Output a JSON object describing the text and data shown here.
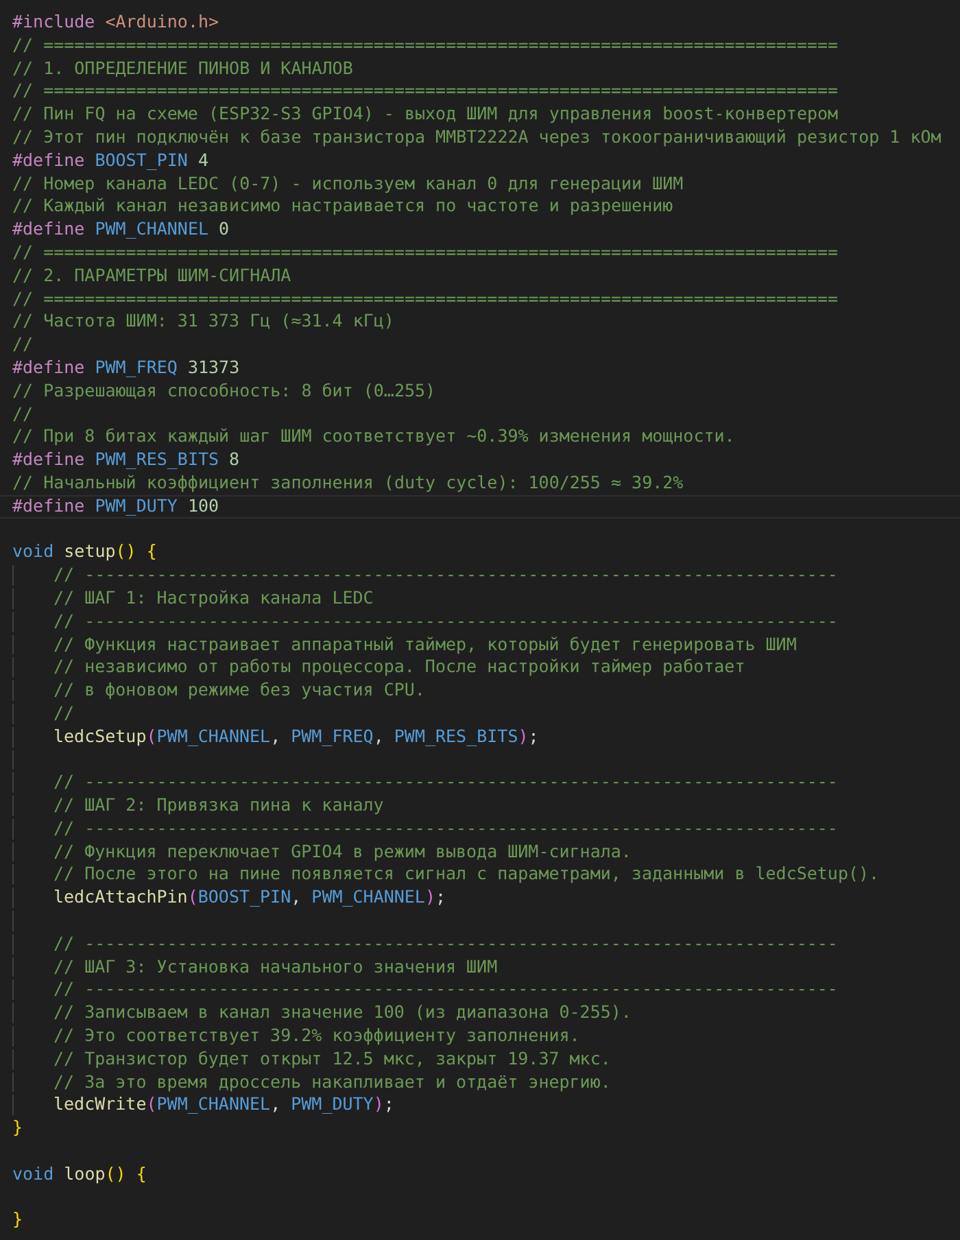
{
  "editor": {
    "lines": [
      {
        "kind": "code",
        "indent": false,
        "current": false,
        "tokens": [
          {
            "kind": "preproc",
            "text": "#include "
          },
          {
            "kind": "string",
            "text": "<Arduino.h>"
          }
        ]
      },
      {
        "kind": "code",
        "indent": false,
        "current": false,
        "tokens": [
          {
            "kind": "comment",
            "text": "// ============================================================================="
          }
        ]
      },
      {
        "kind": "code",
        "indent": false,
        "current": false,
        "tokens": [
          {
            "kind": "comment",
            "text": "// 1. ОПРЕДЕЛЕНИЕ ПИНОВ И КАНАЛОВ"
          }
        ]
      },
      {
        "kind": "code",
        "indent": false,
        "current": false,
        "tokens": [
          {
            "kind": "comment",
            "text": "// ============================================================================="
          }
        ]
      },
      {
        "kind": "code",
        "indent": false,
        "current": false,
        "tokens": [
          {
            "kind": "comment",
            "text": "// Пин FQ на схеме (ESP32-S3 GPIO4) - выход ШИМ для управления boost-конвертером"
          }
        ]
      },
      {
        "kind": "code",
        "indent": false,
        "current": false,
        "tokens": [
          {
            "kind": "comment",
            "text": "// Этот пин подключён к базе транзистора MMBT2222A через токоограничивающий резистор 1 кОм"
          }
        ]
      },
      {
        "kind": "code",
        "indent": false,
        "current": false,
        "tokens": [
          {
            "kind": "preproc",
            "text": "#define "
          },
          {
            "kind": "macro",
            "text": "BOOST_PIN"
          },
          {
            "kind": "number",
            "text": " 4"
          }
        ]
      },
      {
        "kind": "code",
        "indent": false,
        "current": false,
        "tokens": [
          {
            "kind": "comment",
            "text": "// Номер канала LEDC (0-7) - используем канал 0 для генерации ШИМ"
          }
        ]
      },
      {
        "kind": "code",
        "indent": false,
        "current": false,
        "tokens": [
          {
            "kind": "comment",
            "text": "// Каждый канал независимо настраивается по частоте и разрешению"
          }
        ]
      },
      {
        "kind": "code",
        "indent": false,
        "current": false,
        "tokens": [
          {
            "kind": "preproc",
            "text": "#define "
          },
          {
            "kind": "macro",
            "text": "PWM_CHANNEL"
          },
          {
            "kind": "number",
            "text": " 0"
          }
        ]
      },
      {
        "kind": "code",
        "indent": false,
        "current": false,
        "tokens": [
          {
            "kind": "comment",
            "text": "// ============================================================================="
          }
        ]
      },
      {
        "kind": "code",
        "indent": false,
        "current": false,
        "tokens": [
          {
            "kind": "comment",
            "text": "// 2. ПАРАМЕТРЫ ШИМ-СИГНАЛА"
          }
        ]
      },
      {
        "kind": "code",
        "indent": false,
        "current": false,
        "tokens": [
          {
            "kind": "comment",
            "text": "// ============================================================================="
          }
        ]
      },
      {
        "kind": "code",
        "indent": false,
        "current": false,
        "tokens": [
          {
            "kind": "comment",
            "text": "// Частота ШИМ: 31 373 Гц (≈31.4 кГц)"
          }
        ]
      },
      {
        "kind": "code",
        "indent": false,
        "current": false,
        "tokens": [
          {
            "kind": "comment",
            "text": "//"
          }
        ]
      },
      {
        "kind": "code",
        "indent": false,
        "current": false,
        "tokens": [
          {
            "kind": "preproc",
            "text": "#define "
          },
          {
            "kind": "macro",
            "text": "PWM_FREQ"
          },
          {
            "kind": "number",
            "text": " 31373"
          }
        ]
      },
      {
        "kind": "code",
        "indent": false,
        "current": false,
        "tokens": [
          {
            "kind": "comment",
            "text": "// Разрешающая способность: 8 бит (0…255)"
          }
        ]
      },
      {
        "kind": "code",
        "indent": false,
        "current": false,
        "tokens": [
          {
            "kind": "comment",
            "text": "//"
          }
        ]
      },
      {
        "kind": "code",
        "indent": false,
        "current": false,
        "tokens": [
          {
            "kind": "comment",
            "text": "// При 8 битах каждый шаг ШИМ соответствует ~0.39% изменения мощности."
          }
        ]
      },
      {
        "kind": "code",
        "indent": false,
        "current": false,
        "tokens": [
          {
            "kind": "preproc",
            "text": "#define "
          },
          {
            "kind": "macro",
            "text": "PWM_RES_BITS"
          },
          {
            "kind": "number",
            "text": " 8"
          }
        ]
      },
      {
        "kind": "code",
        "indent": false,
        "current": false,
        "tokens": [
          {
            "kind": "comment",
            "text": "// Начальный коэффициент заполнения (duty cycle): 100/255 ≈ 39.2%"
          }
        ]
      },
      {
        "kind": "code",
        "indent": false,
        "current": true,
        "tokens": [
          {
            "kind": "preproc",
            "text": "#define "
          },
          {
            "kind": "macro",
            "text": "PWM_DUTY"
          },
          {
            "kind": "number",
            "text": " 100"
          }
        ]
      },
      {
        "kind": "blank",
        "current": false
      },
      {
        "kind": "code",
        "indent": false,
        "current": false,
        "tokens": [
          {
            "kind": "keyword",
            "text": "void "
          },
          {
            "kind": "func",
            "text": "setup"
          },
          {
            "kind": "bracket1",
            "text": "() {"
          }
        ]
      },
      {
        "kind": "code",
        "indent": true,
        "current": false,
        "tokens": [
          {
            "kind": "comment",
            "text": "// -------------------------------------------------------------------------"
          }
        ]
      },
      {
        "kind": "code",
        "indent": true,
        "current": false,
        "tokens": [
          {
            "kind": "comment",
            "text": "// ШАГ 1: Настройка канала LEDC"
          }
        ]
      },
      {
        "kind": "code",
        "indent": true,
        "current": false,
        "tokens": [
          {
            "kind": "comment",
            "text": "// -------------------------------------------------------------------------"
          }
        ]
      },
      {
        "kind": "code",
        "indent": true,
        "current": false,
        "tokens": [
          {
            "kind": "comment",
            "text": "// Функция настраивает аппаратный таймер, который будет генерировать ШИМ"
          }
        ]
      },
      {
        "kind": "code",
        "indent": true,
        "current": false,
        "tokens": [
          {
            "kind": "comment",
            "text": "// независимо от работы процессора. После настройки таймер работает"
          }
        ]
      },
      {
        "kind": "code",
        "indent": true,
        "current": false,
        "tokens": [
          {
            "kind": "comment",
            "text": "// в фоновом режиме без участия CPU."
          }
        ]
      },
      {
        "kind": "code",
        "indent": true,
        "current": false,
        "tokens": [
          {
            "kind": "comment",
            "text": "//"
          }
        ]
      },
      {
        "kind": "code",
        "indent": true,
        "current": false,
        "tokens": [
          {
            "kind": "func",
            "text": "ledcSetup"
          },
          {
            "kind": "bracket2",
            "text": "("
          },
          {
            "kind": "macro",
            "text": "PWM_CHANNEL"
          },
          {
            "kind": "plain",
            "text": ", "
          },
          {
            "kind": "macro",
            "text": "PWM_FREQ"
          },
          {
            "kind": "plain",
            "text": ", "
          },
          {
            "kind": "macro",
            "text": "PWM_RES_BITS"
          },
          {
            "kind": "bracket2",
            "text": ")"
          },
          {
            "kind": "plain",
            "text": ";"
          }
        ]
      },
      {
        "kind": "blank",
        "indent": true,
        "current": false
      },
      {
        "kind": "code",
        "indent": true,
        "current": false,
        "tokens": [
          {
            "kind": "comment",
            "text": "// -------------------------------------------------------------------------"
          }
        ]
      },
      {
        "kind": "code",
        "indent": true,
        "current": false,
        "tokens": [
          {
            "kind": "comment",
            "text": "// ШАГ 2: Привязка пина к каналу"
          }
        ]
      },
      {
        "kind": "code",
        "indent": true,
        "current": false,
        "tokens": [
          {
            "kind": "comment",
            "text": "// -------------------------------------------------------------------------"
          }
        ]
      },
      {
        "kind": "code",
        "indent": true,
        "current": false,
        "tokens": [
          {
            "kind": "comment",
            "text": "// Функция переключает GPIO4 в режим вывода ШИМ-сигнала."
          }
        ]
      },
      {
        "kind": "code",
        "indent": true,
        "current": false,
        "tokens": [
          {
            "kind": "comment",
            "text": "// После этого на пине появляется сигнал с параметрами, заданными в ledcSetup()."
          }
        ]
      },
      {
        "kind": "code",
        "indent": true,
        "current": false,
        "tokens": [
          {
            "kind": "func",
            "text": "ledcAttachPin"
          },
          {
            "kind": "bracket2",
            "text": "("
          },
          {
            "kind": "macro",
            "text": "BOOST_PIN"
          },
          {
            "kind": "plain",
            "text": ", "
          },
          {
            "kind": "macro",
            "text": "PWM_CHANNEL"
          },
          {
            "kind": "bracket2",
            "text": ")"
          },
          {
            "kind": "plain",
            "text": ";"
          }
        ]
      },
      {
        "kind": "blank",
        "indent": true,
        "current": false
      },
      {
        "kind": "code",
        "indent": true,
        "current": false,
        "tokens": [
          {
            "kind": "comment",
            "text": "// -------------------------------------------------------------------------"
          }
        ]
      },
      {
        "kind": "code",
        "indent": true,
        "current": false,
        "tokens": [
          {
            "kind": "comment",
            "text": "// ШАГ 3: Установка начального значения ШИМ"
          }
        ]
      },
      {
        "kind": "code",
        "indent": true,
        "current": false,
        "tokens": [
          {
            "kind": "comment",
            "text": "// -------------------------------------------------------------------------"
          }
        ]
      },
      {
        "kind": "code",
        "indent": true,
        "current": false,
        "tokens": [
          {
            "kind": "comment",
            "text": "// Записываем в канал значение 100 (из диапазона 0-255)."
          }
        ]
      },
      {
        "kind": "code",
        "indent": true,
        "current": false,
        "tokens": [
          {
            "kind": "comment",
            "text": "// Это соответствует 39.2% коэффициенту заполнения."
          }
        ]
      },
      {
        "kind": "code",
        "indent": true,
        "current": false,
        "tokens": [
          {
            "kind": "comment",
            "text": "// Транзистор будет открыт 12.5 мкс, закрыт 19.37 мкс."
          }
        ]
      },
      {
        "kind": "code",
        "indent": true,
        "current": false,
        "tokens": [
          {
            "kind": "comment",
            "text": "// За это время дроссель накапливает и отдаёт энергию."
          }
        ]
      },
      {
        "kind": "code",
        "indent": true,
        "current": false,
        "tokens": [
          {
            "kind": "func",
            "text": "ledcWrite"
          },
          {
            "kind": "bracket2",
            "text": "("
          },
          {
            "kind": "macro",
            "text": "PWM_CHANNEL"
          },
          {
            "kind": "plain",
            "text": ", "
          },
          {
            "kind": "macro",
            "text": "PWM_DUTY"
          },
          {
            "kind": "bracket2",
            "text": ")"
          },
          {
            "kind": "plain",
            "text": ";"
          }
        ]
      },
      {
        "kind": "code",
        "indent": false,
        "current": false,
        "tokens": [
          {
            "kind": "bracket1",
            "text": "}"
          }
        ]
      },
      {
        "kind": "blank",
        "current": false
      },
      {
        "kind": "code",
        "indent": false,
        "current": false,
        "tokens": [
          {
            "kind": "keyword",
            "text": "void "
          },
          {
            "kind": "func",
            "text": "loop"
          },
          {
            "kind": "bracket1",
            "text": "() {"
          }
        ]
      },
      {
        "kind": "blank",
        "current": false
      },
      {
        "kind": "code",
        "indent": false,
        "current": false,
        "tokens": [
          {
            "kind": "bracket1",
            "text": "}"
          }
        ]
      }
    ]
  }
}
